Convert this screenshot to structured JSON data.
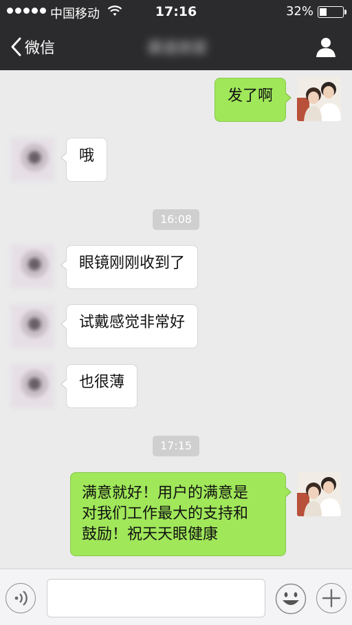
{
  "status_bar": {
    "carrier": "中国移动",
    "time": "17:16",
    "battery": "32%"
  },
  "nav": {
    "back_label": "微信",
    "chat_title": "渠道商家"
  },
  "messages": [
    {
      "type": "out",
      "text": "发了啊"
    },
    {
      "type": "in",
      "text": "哦"
    },
    {
      "type": "time",
      "text": "16:08"
    },
    {
      "type": "in",
      "text": "眼镜刚刚收到了"
    },
    {
      "type": "in",
      "text": "试戴感觉非常好"
    },
    {
      "type": "in",
      "text": "也很薄"
    },
    {
      "type": "time",
      "text": "17:15"
    },
    {
      "type": "out",
      "lines": [
        "满意就好！用户的满意是",
        "对我们工作最大的支持和",
        "鼓励！祝天天眼健康"
      ]
    }
  ],
  "input": {
    "value": "",
    "placeholder": ""
  },
  "icons": {
    "back": "chevron-left-icon",
    "profile": "person-icon",
    "wifi": "wifi-icon",
    "voice": "voice-icon",
    "emoji": "smiley-icon",
    "more": "plus-icon"
  },
  "colors": {
    "header": "#2b2b2d",
    "chat_background": "#ebebeb",
    "outgoing_bubble": "#a0e75a",
    "incoming_bubble": "#ffffff",
    "timestamp_pill": "#cfcfcf"
  }
}
